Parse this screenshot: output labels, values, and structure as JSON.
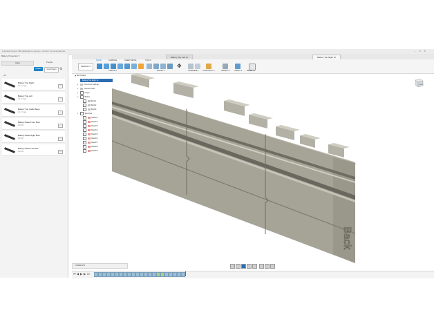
{
  "window": {
    "app_title": "Autodesk Fusion 360 (Education License) - Not For Commercial Use",
    "controls": "–  ☐  ✕"
  },
  "tabs": [
    {
      "label": "Battery Top Left v2"
    },
    {
      "label": "Battery Top Right v2"
    }
  ],
  "data_panel": {
    "header": "Battery Protection  ▾",
    "data_tab": "Data",
    "people_tab": "People",
    "upload_label": "Upload",
    "new_project_label": "New Project",
    "path": "‹  All",
    "files": [
      {
        "name": "Battery Top Right",
        "version": "V2, 4 h ago",
        "badge": "V2"
      },
      {
        "name": "Battery Top Left",
        "version": "V2, 4 h ago",
        "badge": "V2"
      },
      {
        "name": "Battery Top Cable Base",
        "version": "V1, 4 h ago",
        "badge": "V1"
      },
      {
        "name": "Battery Base Front Bow",
        "version": "8/21/20",
        "badge": "V1"
      },
      {
        "name": "Battery Base Right Bow",
        "version": "8/21/20",
        "badge": "V1"
      },
      {
        "name": "Battery Base Left Bow",
        "version": "8/21/20",
        "badge": "V1"
      }
    ]
  },
  "toolbar": {
    "workspace": "DESIGN ▾",
    "tabs": [
      "SOLID",
      "SURFACE",
      "SHEET METAL",
      "TOOLS"
    ],
    "groups": [
      "CREATE ▾",
      "MODIFY ▾",
      "ASSEMBLE ▾",
      "CONSTRUCT ▾",
      "INSPECT ▾",
      "INSERT ▾",
      "SELECT ▾"
    ]
  },
  "browser": {
    "title": "◢  BROWSER",
    "doc_node": "Battery Top Right v2",
    "rows": [
      "Document Settings",
      "Named Views",
      "Origin",
      "Bodies",
      "Body1",
      "Body2",
      "Body3",
      "Sketches",
      "Sketch1",
      "Sketch2",
      "Sketch3",
      "Sketch4",
      "Sketch5",
      "Sketch6",
      "Sketch7",
      "Sketch8",
      "Sketch9"
    ]
  },
  "viewport": {
    "engraved_text": "Back",
    "model_color": "#a6a497",
    "model_light": "#bdbbaf",
    "model_dark": "#8a887c",
    "viewcube_label": "RIGHT"
  },
  "bottom": {
    "comments_label": "COMMENTS"
  },
  "colors": {
    "accent": "#1a82c4",
    "selection": "#2b6cb0"
  }
}
